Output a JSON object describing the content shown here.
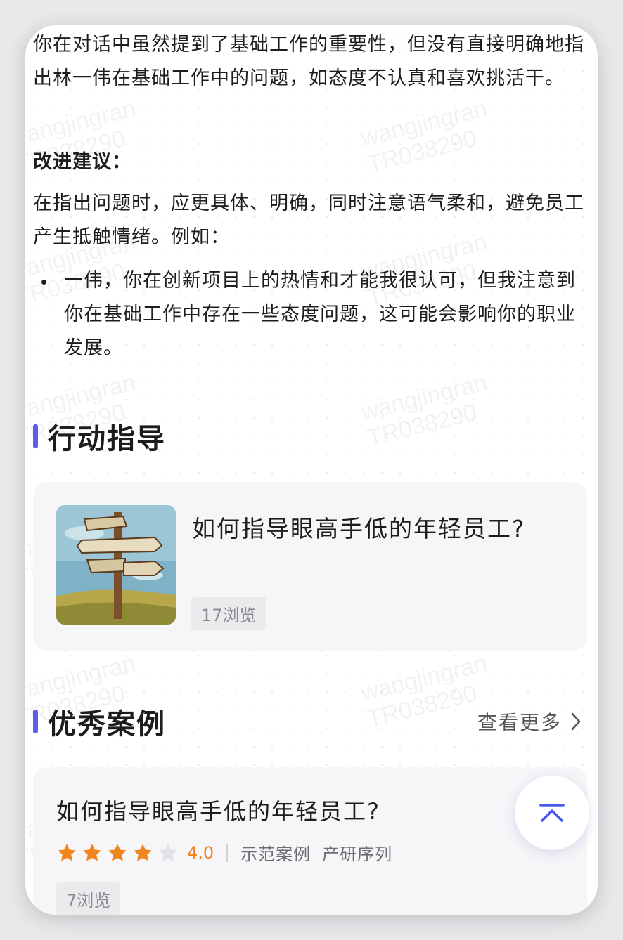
{
  "feedback": {
    "paragraph1": "你在对话中虽然提到了基础工作的重要性，但没有直接明确地指出林一伟在基础工作中的问题，如态度不认真和喜欢挑活干。",
    "suggestion_heading": "改进建议：",
    "paragraph2": "在指出问题时，应更具体、明确，同时注意语气柔和，避免员工产生抵触情绪。例如：",
    "bullets": [
      "一伟，你在创新项目上的热情和才能我很认可，但我注意到你在基础工作中存在一些态度问题，这可能会影响你的职业发展。"
    ]
  },
  "action_guide": {
    "section_title": "行动指导",
    "card": {
      "title": "如何指导眼高手低的年轻员工?",
      "views": "17浏览",
      "image_icon": "signpost-illustration"
    }
  },
  "cases": {
    "section_title": "优秀案例",
    "more_label": "查看更多",
    "card": {
      "title": "如何指导眼高手低的年轻员工?",
      "rating": 4.0,
      "rating_text": "4.0",
      "stars_filled": 4,
      "stars_total": 5,
      "tags": [
        "示范案例",
        "产研序列"
      ],
      "views": "7浏览"
    }
  },
  "watermark": {
    "line1": "wangjingran",
    "line2": "TR038290"
  },
  "colors": {
    "accent_bar": "#5b5cf0",
    "star_filled": "#f0851e",
    "star_empty": "#e2e2e6",
    "fab_icon": "#4a5be8"
  },
  "icons": {
    "more": "chevron-right-icon",
    "fab": "back-to-top-icon"
  }
}
